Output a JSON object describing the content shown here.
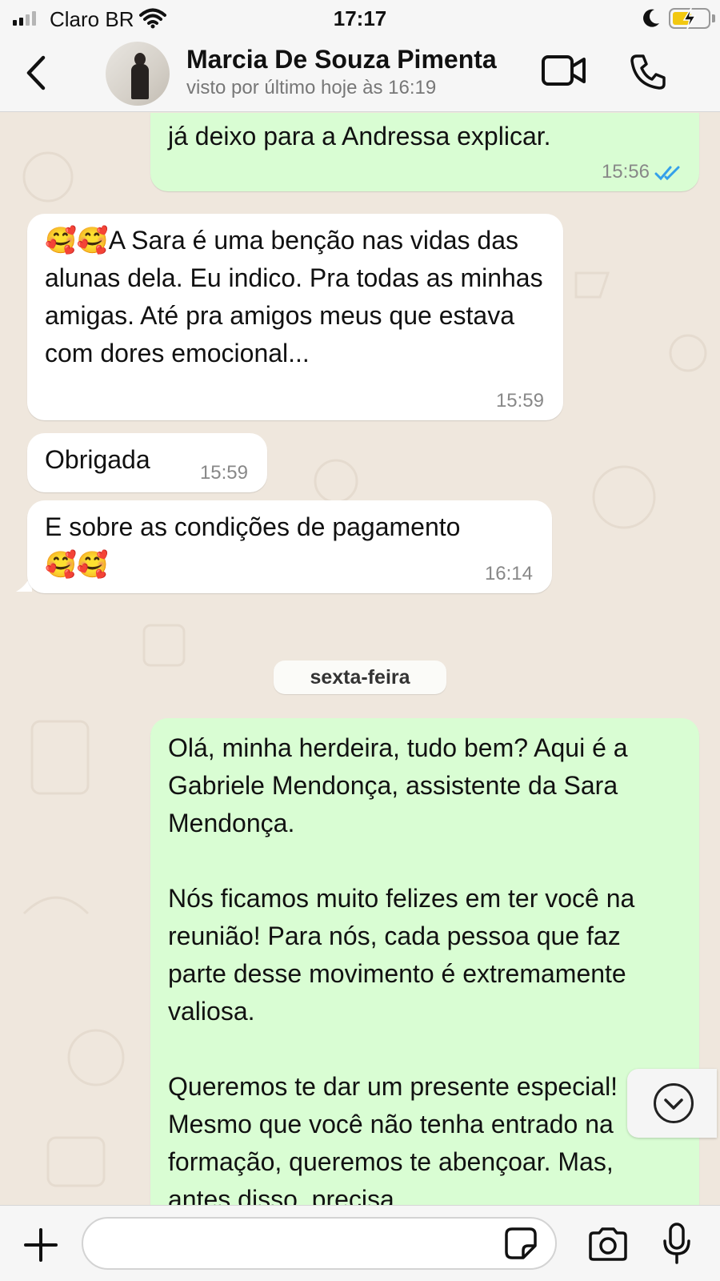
{
  "status_bar": {
    "carrier": "Claro BR",
    "time": "17:17",
    "battery_level": 0.55,
    "icons": [
      "signal-icon",
      "wifi-icon",
      "moon-icon",
      "battery-charging-icon"
    ]
  },
  "header": {
    "back_icon": "chevron-left-icon",
    "contact_name": "Marcia De Souza Pimenta",
    "last_seen": "visto por último hoje às 16:19",
    "video_icon": "video-camera-icon",
    "call_icon": "phone-icon"
  },
  "messages": [
    {
      "direction": "out",
      "text": "já deixo para a Andressa explicar.",
      "time": "15:56",
      "status": "read"
    },
    {
      "direction": "in",
      "emoji_prefix": "🥰🥰",
      "text": "A Sara é uma benção nas vidas das alunas dela. Eu indico. Pra todas as minhas amigas. Até pra amigos meus que estava com dores emocional...",
      "time": "15:59"
    },
    {
      "direction": "in",
      "text": "Obrigada",
      "time": "15:59"
    },
    {
      "direction": "in",
      "text": "E sobre as condições de pagamento",
      "emoji_suffix": "🥰🥰",
      "time": "16:14"
    }
  ],
  "date_divider": "sexta-feira",
  "long_message": {
    "direction": "out",
    "text": "Olá, minha herdeira, tudo bem? Aqui é a Gabriele Mendonça, assistente da Sara Mendonça.\n\nNós ficamos muito felizes em ter você na reunião! Para nós, cada pessoa que faz parte desse movimento é extremamente valiosa.\n\nQueremos te dar um presente especial! Mesmo que você não tenha entrado na formação, queremos te abençoar. Mas, antes disso, precisa"
  },
  "scroll_button_icon": "chevron-down-circle-icon",
  "input_bar": {
    "plus_icon": "plus-icon",
    "placeholder": "",
    "sticker_icon": "sticker-icon",
    "camera_icon": "camera-icon",
    "mic_icon": "microphone-icon"
  },
  "colors": {
    "outgoing_bubble": "#d9fdd3",
    "incoming_bubble": "#ffffff",
    "chat_background": "#efe7dd",
    "read_ticks": "#34a0ea"
  }
}
